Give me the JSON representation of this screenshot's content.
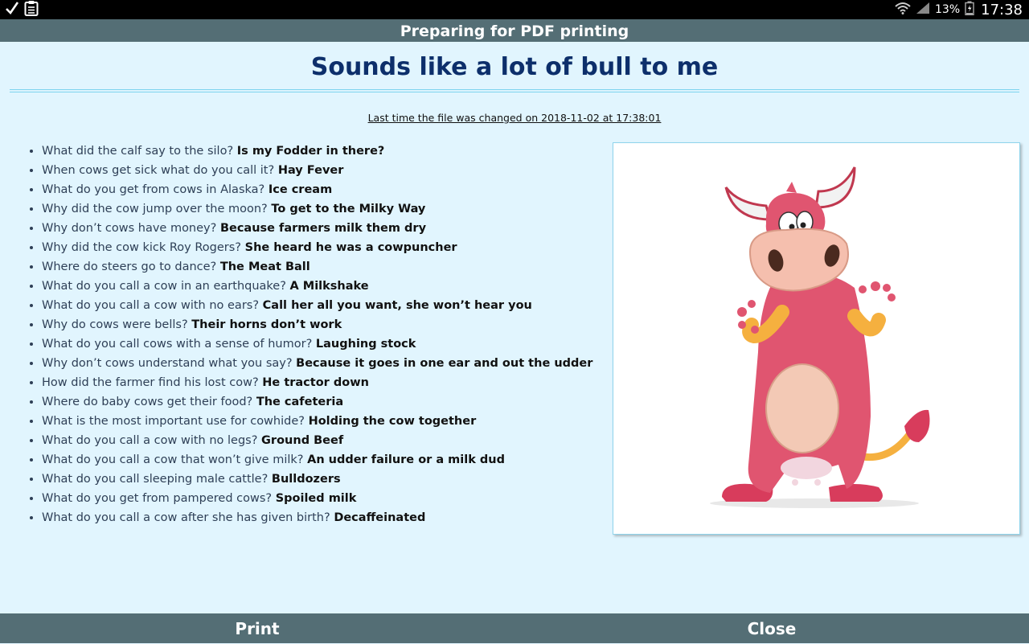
{
  "status_bar": {
    "battery_percent": "13%",
    "time": "17:38",
    "icons": [
      "check-icon",
      "clipboard-icon",
      "wifi-icon",
      "signal-icon",
      "battery-icon"
    ]
  },
  "header": {
    "title": "Preparing for PDF printing"
  },
  "document": {
    "title": "Sounds like a lot of bull to me",
    "last_changed": "Last time the file was changed on 2018-11-02 at 17:38:01",
    "jokes": [
      {
        "q": "What did the calf say to the silo?",
        "a": "Is my Fodder in there?"
      },
      {
        "q": "When cows get sick what do you call it?",
        "a": "Hay Fever"
      },
      {
        "q": "What do you get from cows in Alaska?",
        "a": "Ice cream"
      },
      {
        "q": "Why did the cow jump over the moon?",
        "a": "To get to the Milky Way"
      },
      {
        "q": "Why don’t cows have money?",
        "a": "Because farmers milk them dry"
      },
      {
        "q": "Why did the cow kick Roy Rogers?",
        "a": "She heard he was a cowpuncher"
      },
      {
        "q": "Where do steers go to dance?",
        "a": "The Meat Ball"
      },
      {
        "q": "What do you call a cow in an earthquake?",
        "a": "A Milkshake"
      },
      {
        "q": "What do you call a cow with no ears?",
        "a": "Call her all you want, she won’t hear you"
      },
      {
        "q": "Why do cows were bells?",
        "a": "Their horns don’t work"
      },
      {
        "q": "What do you call cows with a sense of humor?",
        "a": "Laughing stock"
      },
      {
        "q": "Why don’t cows understand what you say?",
        "a": "Because it goes in one ear and out the udder"
      },
      {
        "q": "How did the farmer find his lost cow?",
        "a": "He tractor down"
      },
      {
        "q": "Where do baby cows get their food?",
        "a": "The cafeteria"
      },
      {
        "q": "What is the most important use for cowhide?",
        "a": "Holding the cow together"
      },
      {
        "q": "What do you call a cow with no legs?",
        "a": "Ground Beef"
      },
      {
        "q": "What do you call a cow that won’t give milk?",
        "a": "An udder failure or a milk dud"
      },
      {
        "q": "What do you call sleeping male cattle?",
        "a": "Bulldozers"
      },
      {
        "q": "What do you get from pampered cows?",
        "a": "Spoiled milk"
      },
      {
        "q": "What do you call a cow after she has given birth?",
        "a": "Decaffeinated"
      }
    ],
    "image": "cartoon-cow-illustration"
  },
  "footer": {
    "print_label": "Print",
    "close_label": "Close"
  },
  "colors": {
    "status_bar": "#000000",
    "bars": "#546e75",
    "background": "#e1f5fe",
    "title": "#0d2f6b",
    "rule": "#7dd3ee",
    "cow_body": "#e05570",
    "cow_belly": "#f3c9b5",
    "cow_arms": "#f5b03f"
  }
}
